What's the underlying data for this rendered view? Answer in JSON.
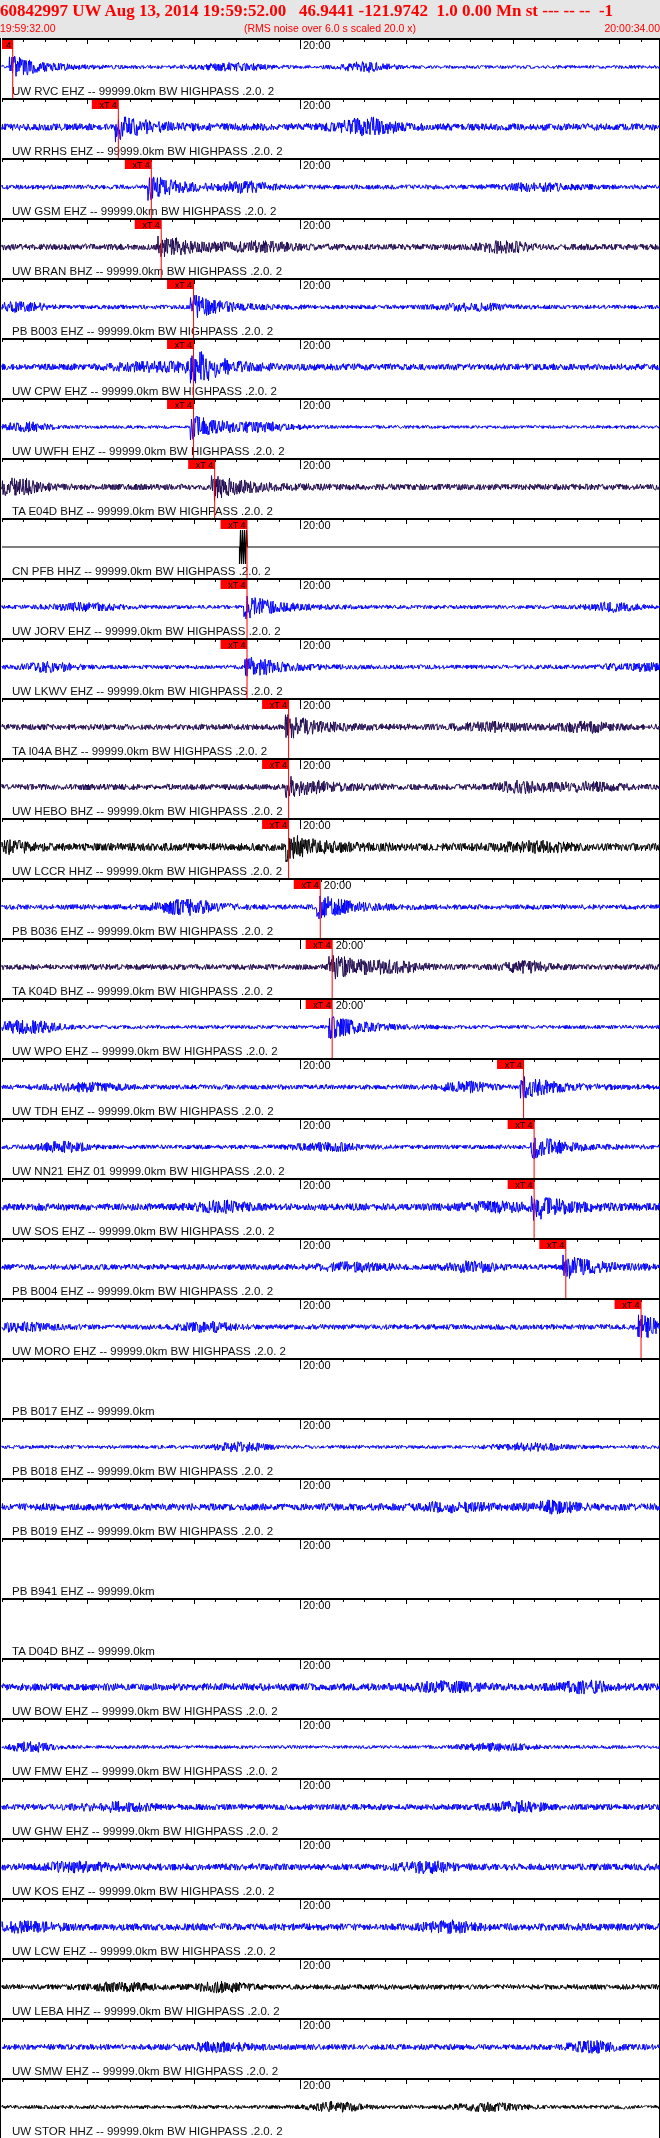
{
  "header": {
    "title": "60842997 UW Aug 13, 2014 19:59:52.00   46.9441 -121.9742  1.0 0.00 Mn st --- -- --  -1",
    "start_time": "19:59:32.00",
    "note": "(RMS noise over 6.0 s scaled 20.0 x)",
    "end_time": "20:00:34.00"
  },
  "traces": [
    {
      "label": "UW RVC EHZ -- 99999.0km BW HIGHPASS .2.0. 2",
      "axis_label": "20:00",
      "color": "#0000ff",
      "kind": "waveform",
      "pick": {
        "label": "4",
        "level": 0.017
      }
    },
    {
      "label": "UW RRHS EHZ -- 99999.0km BW HIGHPASS .2.0. 2",
      "axis_label": "20:00",
      "color": "#0000ff",
      "kind": "waveform",
      "pick": {
        "label": "xT 4",
        "level": 0.177
      }
    },
    {
      "label": "UW GSM EHZ -- 99999.0km BW HIGHPASS .2.0. 2",
      "axis_label": "20:00",
      "color": "#0000ff",
      "kind": "waveform",
      "pick": {
        "label": "xT 4",
        "level": 0.227
      }
    },
    {
      "label": "UW BRAN BHZ -- 99999.0km BW HIGHPASS .2.0. 2",
      "axis_label": "20:00",
      "color": "#200a50",
      "kind": "waveform",
      "pick": {
        "label": "xT 4",
        "level": 0.242
      }
    },
    {
      "label": "PB B003 EHZ -- 99999.0km BW HIGHPASS .2.0. 2",
      "axis_label": "20:00",
      "color": "#0000ff",
      "kind": "waveform",
      "pick": {
        "label": "xT 4",
        "level": 0.291
      }
    },
    {
      "label": "UW CPW EHZ -- 99999.0km BW HIGHPASS .2.0. 2",
      "axis_label": "20:00",
      "color": "#0000ff",
      "kind": "waveform",
      "pick": {
        "label": "xT 4",
        "level": 0.291
      }
    },
    {
      "label": "UW UWFH EHZ -- 99999.0km BW HIGHPASS .2.0. 2",
      "axis_label": "20:00",
      "color": "#0000ff",
      "kind": "waveform",
      "pick": {
        "label": "xT 4",
        "level": 0.291
      }
    },
    {
      "label": "TA E04D BHZ -- 99999.0km BW HIGHPASS .2.0. 2",
      "axis_label": "20:00",
      "color": "#200a50",
      "kind": "waveform",
      "pick": {
        "label": "xT 4",
        "level": 0.323
      }
    },
    {
      "label": "CN PFB HHZ -- 99999.0km BW HIGHPASS .2.0. 2",
      "axis_label": "20:00",
      "color": "#000000",
      "kind": "flatline",
      "pick": {
        "label": "xT 4",
        "level": 0.372
      }
    },
    {
      "label": "UW JORV EHZ -- 99999.0km BW HIGHPASS .2.0. 2",
      "axis_label": "20:00",
      "color": "#0000ff",
      "kind": "waveform",
      "pick": {
        "label": "xT 4",
        "level": 0.372
      }
    },
    {
      "label": "UW LKWV EHZ -- 99999.0km BW HIGHPASS .2.0. 2",
      "axis_label": "20:00",
      "color": "#0000ff",
      "kind": "waveform",
      "pick": {
        "label": "xT 4",
        "level": 0.372
      }
    },
    {
      "label": "TA I04A BHZ -- 99999.0km BW HIGHPASS .2.0. 2",
      "axis_label": "20:00",
      "color": "#200a50",
      "kind": "waveform",
      "pick": {
        "label": "xT 4",
        "level": 0.435
      }
    },
    {
      "label": "UW HEBO BHZ -- 99999.0km BW HIGHPASS .2.0. 2",
      "axis_label": "20:00",
      "color": "#200a50",
      "kind": "waveform",
      "pick": {
        "label": "xT 4",
        "level": 0.435
      }
    },
    {
      "label": "UW LCCR HHZ -- 99999.0km BW HIGHPASS .2.0. 2",
      "axis_label": "20:00",
      "color": "#000000",
      "kind": "waveform",
      "pick": {
        "label": "xT 4",
        "level": 0.435
      }
    },
    {
      "label": "PB B036 EHZ -- 99999.0km BW HIGHPASS .2.0. 2",
      "axis_label": "20:00",
      "color": "#0000ff",
      "kind": "waveform",
      "pick": {
        "label": "xT 4",
        "level": 0.483
      }
    },
    {
      "label": "TA K04D BHZ -- 99999.0km BW HIGHPASS .2.0. 2",
      "axis_label": "20:00",
      "color": "#200a50",
      "kind": "waveform",
      "pick": {
        "label": "xT 4",
        "level": 0.501
      }
    },
    {
      "label": "UW WPO EHZ -- 99999.0km BW HIGHPASS .2.0. 2",
      "axis_label": "20:00",
      "color": "#0000ff",
      "kind": "waveform",
      "pick": {
        "label": "xT 4",
        "level": 0.501
      }
    },
    {
      "label": "UW TDH EHZ -- 99999.0km BW HIGHPASS .2.0. 2",
      "axis_label": "20:00",
      "color": "#0000ff",
      "kind": "waveform",
      "pick": {
        "label": "xT 4",
        "level": 0.791
      }
    },
    {
      "label": "UW NN21 EHZ 01 99999.0km BW HIGHPASS .2.0. 2",
      "axis_label": "20:00",
      "color": "#0000ff",
      "kind": "waveform",
      "pick": {
        "label": "xT 4",
        "level": 0.807
      }
    },
    {
      "label": "UW SOS EHZ -- 99999.0km BW HIGHPASS .2.0. 2",
      "axis_label": "20:00",
      "color": "#0000ff",
      "kind": "waveform",
      "pick": {
        "label": "xT 4",
        "level": 0.807
      }
    },
    {
      "label": "PB B004 EHZ -- 99999.0km BW HIGHPASS .2.0. 2",
      "axis_label": "20:00",
      "color": "#0000ff",
      "kind": "waveform",
      "pick": {
        "label": "xT 4",
        "level": 0.855
      }
    },
    {
      "label": "UW MORO EHZ -- 99999.0km BW HIGHPASS .2.0. 2",
      "axis_label": "20:00",
      "color": "#0000ff",
      "kind": "waveform",
      "pick": {
        "label": "xT 4",
        "level": 0.969
      }
    },
    {
      "label": "PB B017 EHZ -- 99999.0km",
      "axis_label": "20:00",
      "kind": "empty"
    },
    {
      "label": "PB B018 EHZ -- 99999.0km BW HIGHPASS .2.0. 2",
      "axis_label": "20:00",
      "color": "#0000ff",
      "kind": "waveform"
    },
    {
      "label": "PB B019 EHZ -- 99999.0km BW HIGHPASS .2.0. 2",
      "axis_label": "20:00",
      "color": "#0000ff",
      "kind": "waveform"
    },
    {
      "label": "PB B941 EHZ -- 99999.0km",
      "axis_label": "20:00",
      "kind": "empty"
    },
    {
      "label": "TA D04D BHZ -- 99999.0km",
      "axis_label": "20:00",
      "kind": "empty"
    },
    {
      "label": "UW BOW EHZ -- 99999.0km BW HIGHPASS .2.0. 2",
      "axis_label": "20:00",
      "color": "#0000ff",
      "kind": "waveform"
    },
    {
      "label": "UW FMW EHZ -- 99999.0km BW HIGHPASS .2.0. 2",
      "axis_label": "20:00",
      "color": "#0000ff",
      "kind": "waveform"
    },
    {
      "label": "UW GHW EHZ -- 99999.0km BW HIGHPASS .2.0. 2",
      "axis_label": "20:00",
      "color": "#0000ff",
      "kind": "waveform"
    },
    {
      "label": "UW KOS EHZ -- 99999.0km BW HIGHPASS .2.0. 2",
      "axis_label": "20:00",
      "color": "#0000ff",
      "kind": "waveform"
    },
    {
      "label": "UW LCW EHZ -- 99999.0km BW HIGHPASS .2.0. 2",
      "axis_label": "20:00",
      "color": "#0000ff",
      "kind": "waveform"
    },
    {
      "label": "UW LEBA HHZ -- 99999.0km BW HIGHPASS .2.0. 2",
      "axis_label": "20:00",
      "color": "#000000",
      "kind": "waveform"
    },
    {
      "label": "UW SMW EHZ -- 99999.0km BW HIGHPASS .2.0. 2",
      "axis_label": "20:00",
      "color": "#0000ff",
      "kind": "waveform"
    },
    {
      "label": "UW STOR HHZ -- 99999.0km BW HIGHPASS .2.0. 2",
      "axis_label": "20:00",
      "color": "#000000",
      "kind": "waveform"
    }
  ]
}
